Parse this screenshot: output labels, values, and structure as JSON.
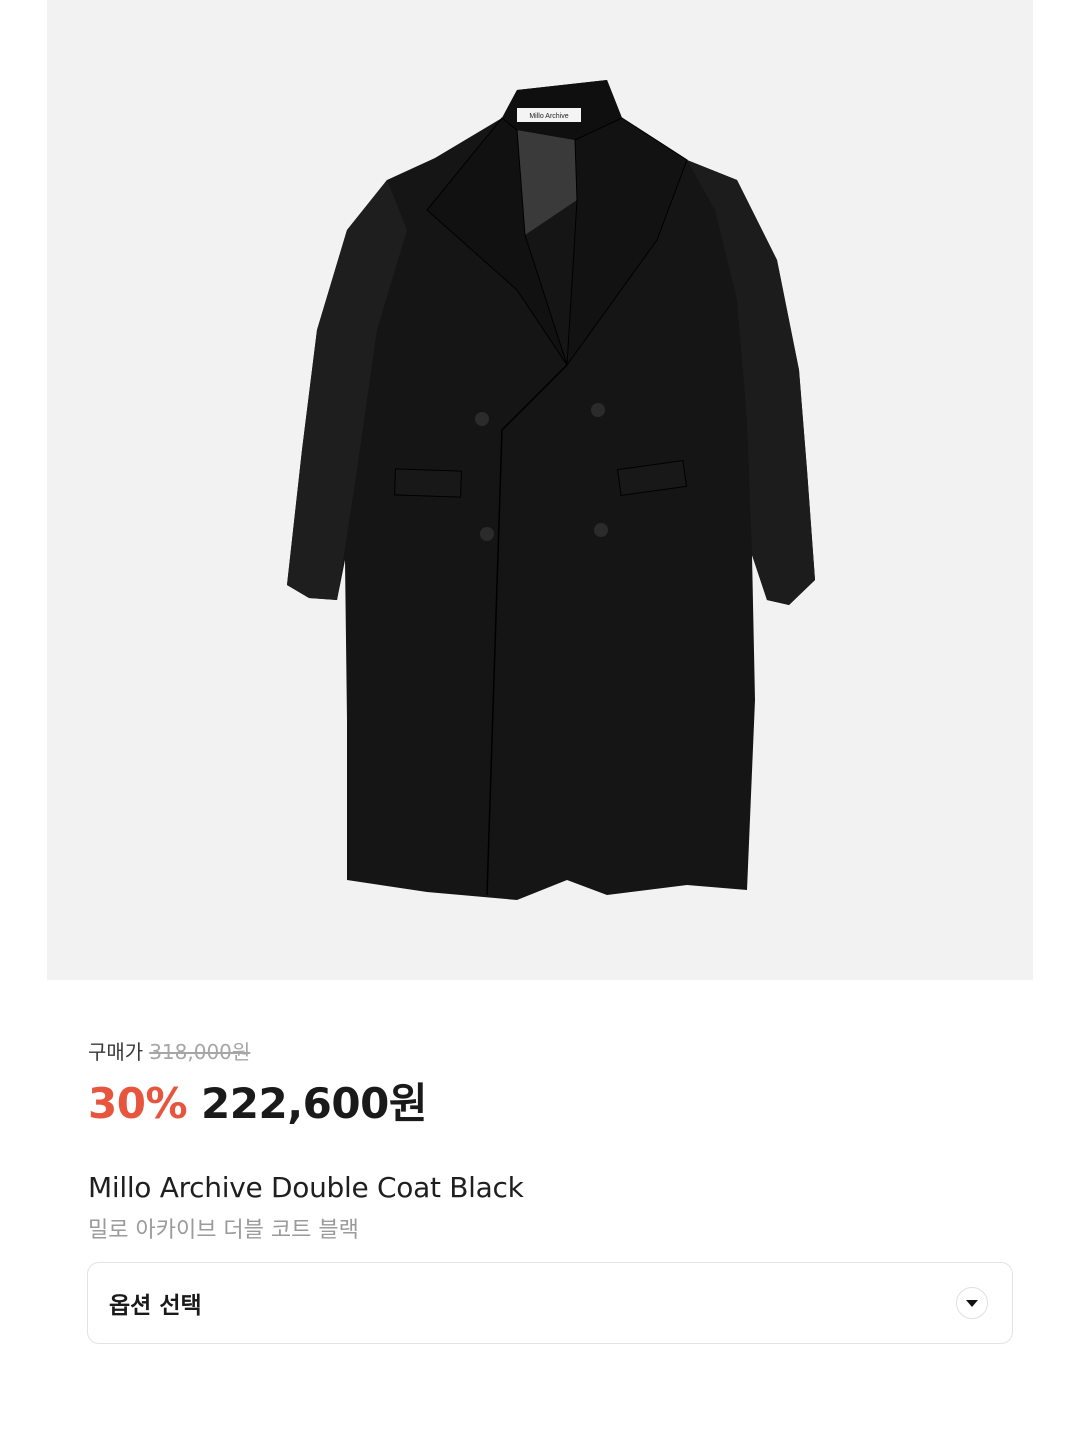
{
  "product": {
    "image_alt_icon": "coat-photo",
    "label_tag_text": "Millo Archive",
    "buy_label": "구매가",
    "original_price": "318,000원",
    "discount": "30%",
    "sale_price": "222,600원",
    "name_en": "Millo Archive Double Coat Black",
    "name_ko": "밀로 아카이브 더블 코트 블랙"
  },
  "option": {
    "label": "옵션 선택",
    "icon": "chevron-down-icon"
  },
  "colors": {
    "discount": "#e8553e",
    "hero_bg": "#f2f2f2",
    "text": "#1a1a1a",
    "muted": "#9a9a9a"
  }
}
